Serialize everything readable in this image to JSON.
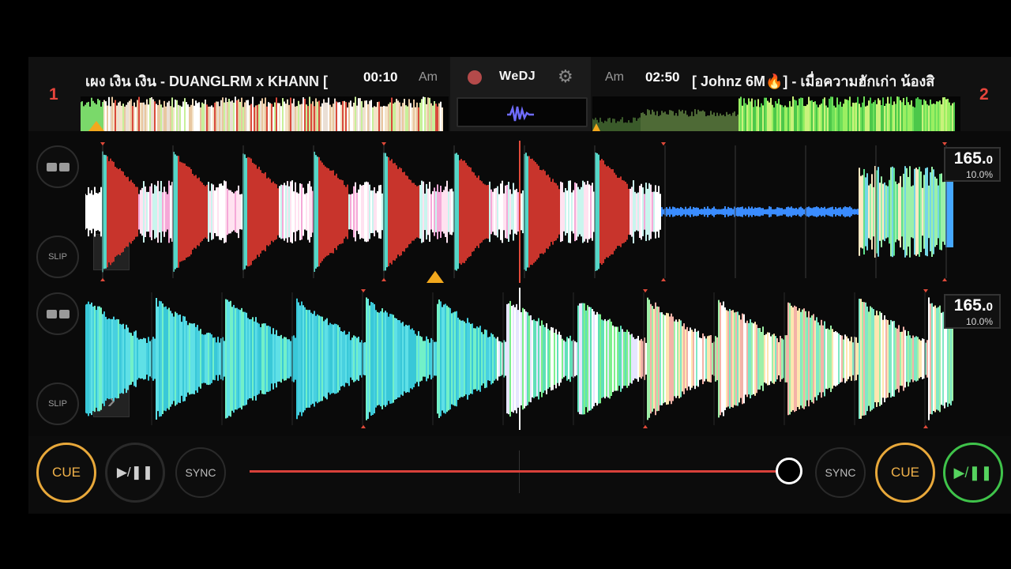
{
  "app": {
    "name": "WeDJ"
  },
  "deck1": {
    "number": "1",
    "title": "เผง เงิน เงิน - DUANGLRM x KHANN [",
    "time": "00:10",
    "key": "Am",
    "bpm_main": "165.",
    "bpm_decimal": "0",
    "pitch": "10.0%",
    "slip_label": "SLIP"
  },
  "deck2": {
    "number": "2",
    "title": "[ Johnz 6M🔥] - เมื่อความฮักเก่า น้องสิ",
    "time": "02:50",
    "key": "Am",
    "bpm_main": "165.",
    "bpm_decimal": "0",
    "pitch": "10.0%",
    "slip_label": "SLIP"
  },
  "transport": {
    "cue_label": "CUE",
    "play_label": "▶/❚❚",
    "sync_label": "SYNC",
    "crossfader_position": 1.0
  },
  "icons": {
    "record": "record-icon",
    "settings": "gear-icon",
    "waveform_mode": "waveform-icon",
    "loop": "loop-icon",
    "next": "chevron-right-icon"
  },
  "colors": {
    "accent_red": "#e8453c",
    "cue_orange": "#e8a83a",
    "play_green": "#3fc34a"
  }
}
